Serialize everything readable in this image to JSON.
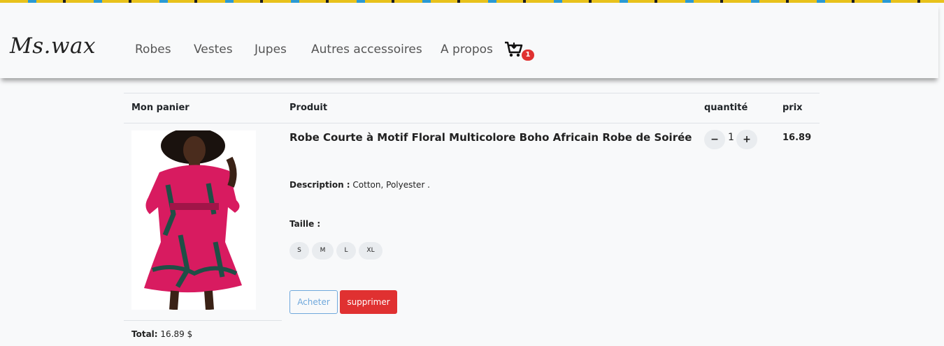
{
  "brand": {
    "name": "Ms.wax"
  },
  "nav": {
    "items": [
      "Robes",
      "Vestes",
      "Jupes",
      "Autres accessoires",
      "A propos"
    ],
    "cart_count": "1"
  },
  "table": {
    "headers": {
      "cart": "Mon panier",
      "product": "Produit",
      "quantity": "quantité",
      "price": "prix"
    }
  },
  "item": {
    "title": "Robe Courte à Motif Floral Multicolore Boho Africain Robe de Soirée",
    "description_label": "Description :",
    "description": "Cotton, Polyester .",
    "size_label": "Taille :",
    "sizes": [
      "S",
      "M",
      "L",
      "XL"
    ],
    "quantity": "1",
    "minus_label": "−",
    "plus_label": "+",
    "price": "16.89",
    "buy_label": "Acheter",
    "remove_label": "supprimer"
  },
  "summary": {
    "total_label": "Total:",
    "total_value": "16.89 $"
  },
  "colors": {
    "accent_red": "#e03131",
    "outline_blue": "#6fa8dc",
    "background": "#f8f9fa"
  }
}
